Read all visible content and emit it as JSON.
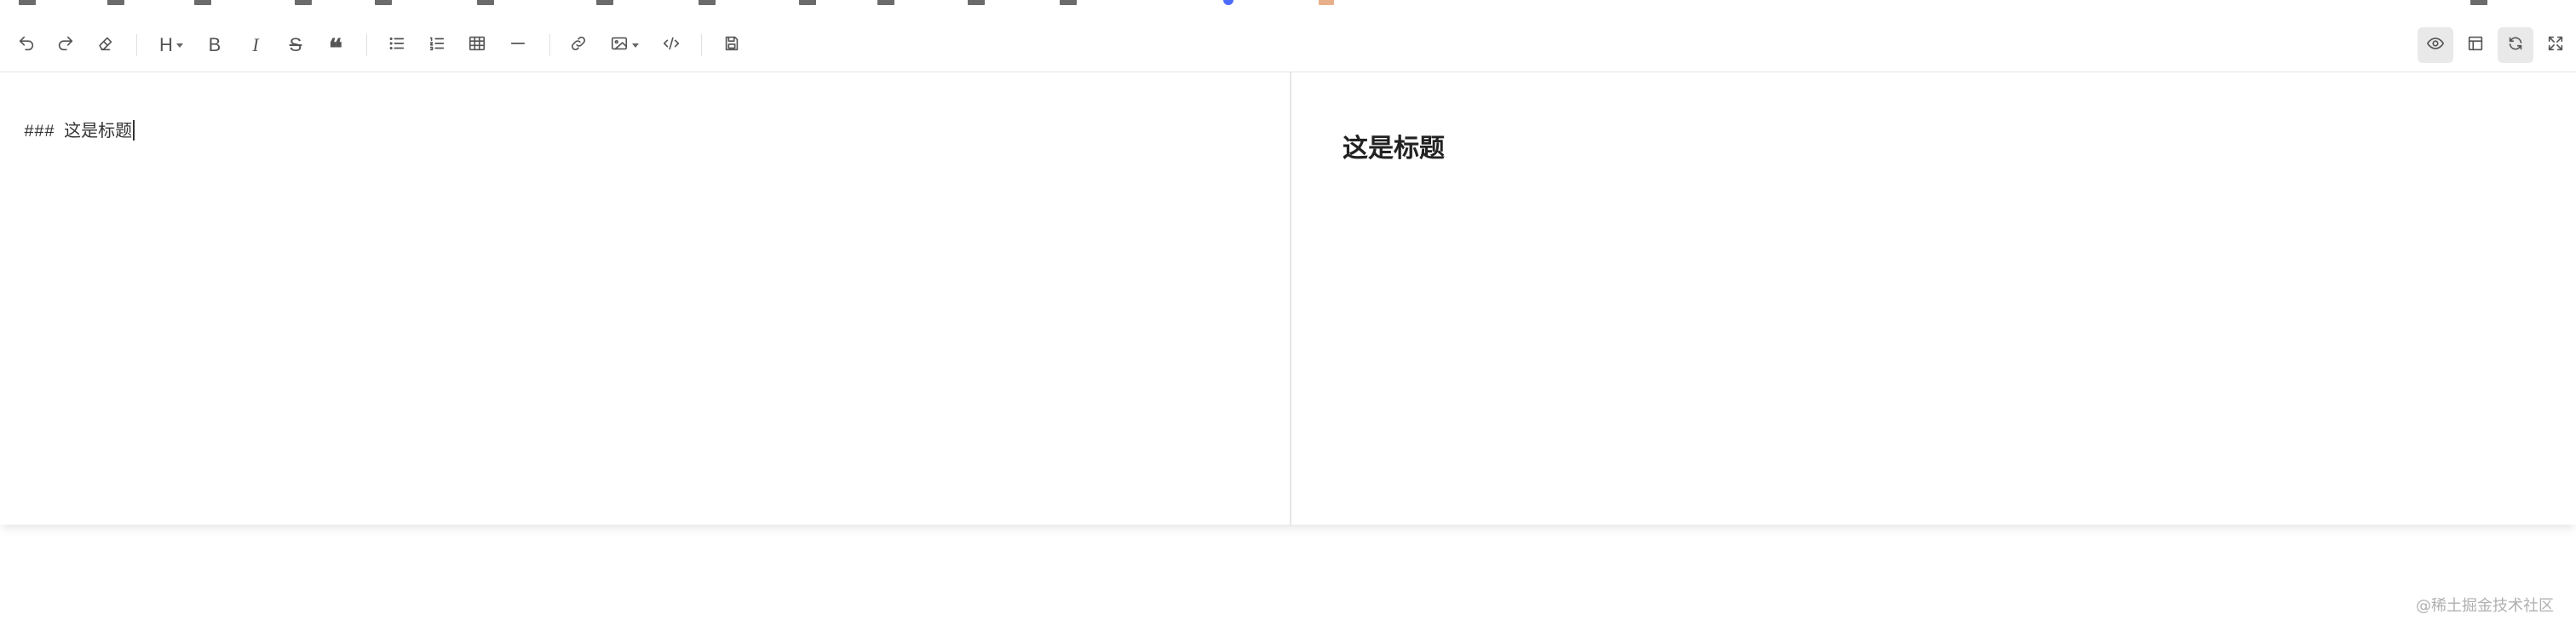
{
  "editor": {
    "source_text": "这是标题",
    "source_prefix": "###",
    "preview_heading": "这是标题"
  },
  "toolbar": {
    "left_groups": [
      [
        "undo-icon",
        "redo-icon",
        "eraser-icon"
      ],
      [
        "heading-icon",
        "bold-icon",
        "italic-icon",
        "strikethrough-icon",
        "quote-icon"
      ],
      [
        "unordered-list-icon",
        "ordered-list-icon",
        "table-icon",
        "horizontal-rule-icon"
      ],
      [
        "link-icon",
        "image-icon",
        "code-icon"
      ],
      [
        "save-icon"
      ]
    ],
    "right_buttons": [
      "eye-icon",
      "layout-icon",
      "sync-scroll-icon",
      "fullscreen-icon"
    ],
    "active": [
      "eye-icon",
      "sync-scroll-icon"
    ],
    "heading_label": "H",
    "bold_label": "B",
    "italic_label": "I",
    "strike_label": "S",
    "quote_label": "❝"
  },
  "watermark": "@稀土掘金技术社区",
  "colors": {
    "icon": "#555555",
    "active_bg": "#e9e9e9",
    "divider": "#e6e6e6",
    "heading_text": "#222222",
    "watermark": "#b0b0b0"
  }
}
